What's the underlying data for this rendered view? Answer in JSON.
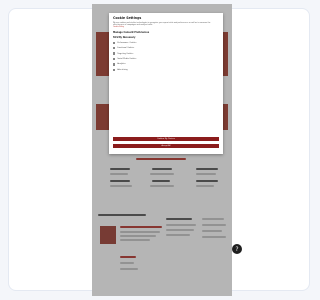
{
  "modal": {
    "title": "Cookie Settings",
    "intro": "We use cookies and similar technologies to recognize your repeat visits and preferences, as well as to measure the effectiveness of campaigns and analyze traffic.",
    "link": "Cookie Policy",
    "manage_label": "Manage Consent Preferences",
    "section_label": "Strictly Necessary",
    "options": [
      "Performance Cookies",
      "Functional Cookies",
      "Targeting Cookies",
      "Social Media Cookies",
      "Analytics",
      "Advertising"
    ],
    "confirm_label": "Confirm My Choices",
    "accept_label": "Accept All"
  },
  "help_icon": "help-icon"
}
